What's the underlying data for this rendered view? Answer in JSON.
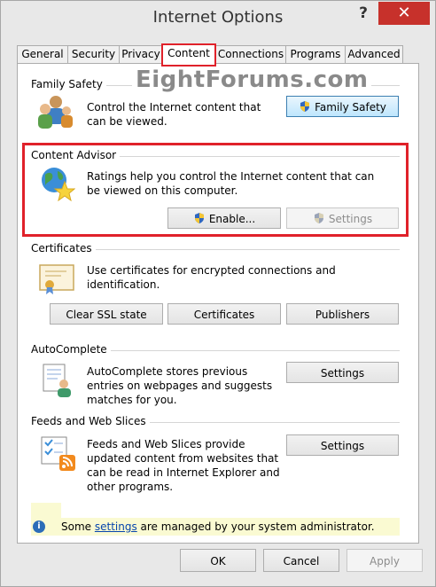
{
  "window": {
    "title": "Internet Options",
    "help_label": "?",
    "close_label": "✕"
  },
  "tabs": [
    {
      "label": "General"
    },
    {
      "label": "Security"
    },
    {
      "label": "Privacy"
    },
    {
      "label": "Content"
    },
    {
      "label": "Connections"
    },
    {
      "label": "Programs"
    },
    {
      "label": "Advanced"
    }
  ],
  "active_tab": "Content",
  "watermark": "EightForums.com",
  "family_safety": {
    "heading": "Family Safety",
    "description": "Control the Internet content that can be viewed.",
    "button_label": "Family Safety"
  },
  "content_advisor": {
    "heading": "Content Advisor",
    "description": "Ratings help you control the Internet content that can be viewed on this computer.",
    "enable_label": "Enable...",
    "settings_label": "Settings"
  },
  "certificates": {
    "heading": "Certificates",
    "description": "Use certificates for encrypted connections and identification.",
    "clear_ssl_label": "Clear SSL state",
    "certificates_label": "Certificates",
    "publishers_label": "Publishers"
  },
  "autocomplete": {
    "heading": "AutoComplete",
    "description": "AutoComplete stores previous entries on webpages and suggests matches for you.",
    "settings_label": "Settings"
  },
  "feeds": {
    "heading": "Feeds and Web Slices",
    "description": "Feeds and Web Slices provide updated content from websites that can be read in Internet Explorer and other programs.",
    "settings_label": "Settings"
  },
  "info_bar": {
    "prefix": "Some ",
    "link": "settings",
    "suffix": " are managed by your system administrator."
  },
  "footer": {
    "ok_label": "OK",
    "cancel_label": "Cancel",
    "apply_label": "Apply"
  },
  "colors": {
    "highlight": "#e0212a",
    "close_button": "#c7312b",
    "info_bar": "#fafad2"
  }
}
